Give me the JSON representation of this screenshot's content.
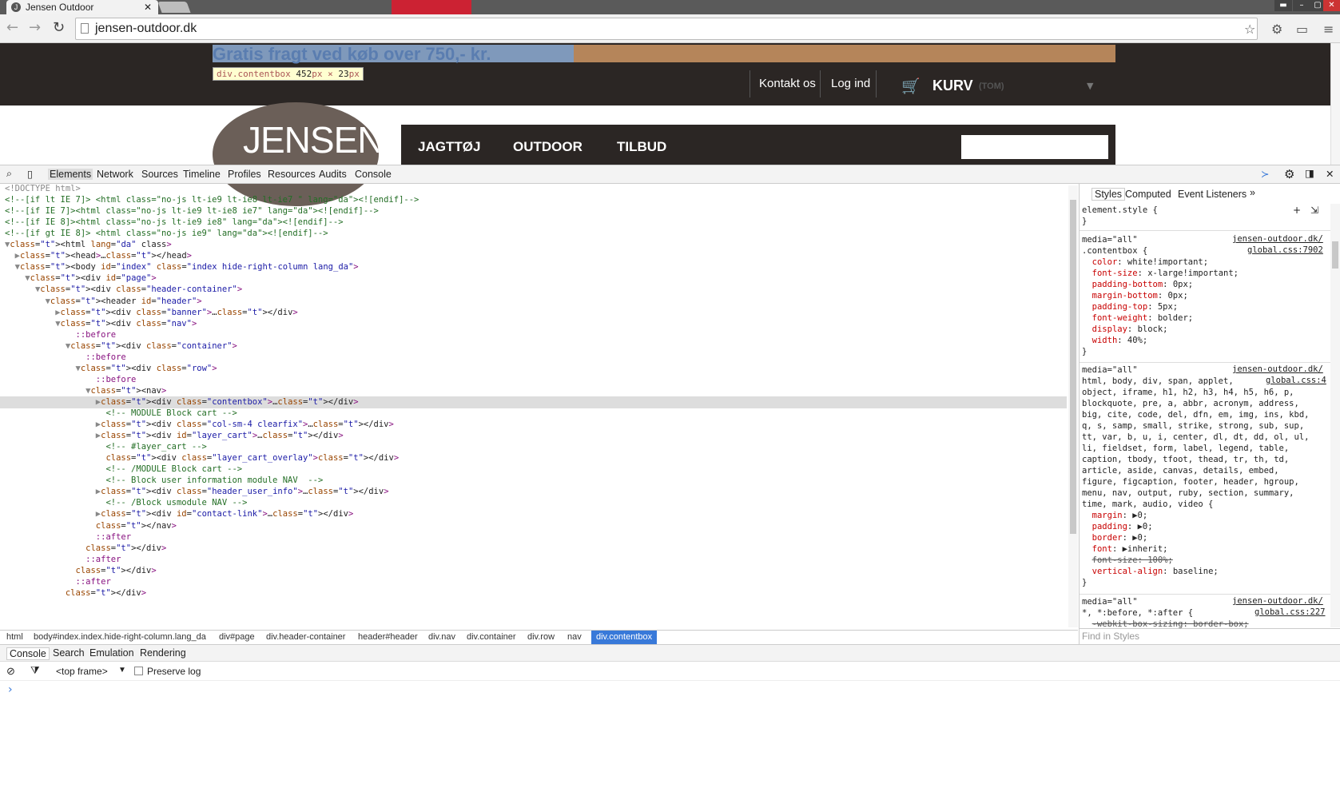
{
  "browser": {
    "tab_title": "Jensen Outdoor",
    "url": "jensen-outdoor.dk"
  },
  "site": {
    "promo": "Gratis fragt ved køb over 750,- kr.",
    "tooltip_selector": "div.contentbox",
    "tooltip_width": "452",
    "tooltip_height": "23",
    "tooltip_px": "px",
    "tooltip_x": "×",
    "contact": "Kontakt os",
    "login": "Log ind",
    "cart": "KURV",
    "cart_status": "(TOM)",
    "logo": "JENSEN",
    "menu": [
      "JAGTTØJ",
      "OUTDOOR",
      "TILBUD"
    ]
  },
  "devtools": {
    "tabs": [
      "Elements",
      "Network",
      "Sources",
      "Timeline",
      "Profiles",
      "Resources",
      "Audits",
      "Console"
    ],
    "code_lines": [
      "<!DOCTYPE html>",
      "<!--[if lt IE 7]> <html class=\"no-js lt-ie9 lt-ie8 lt-ie7 \" lang=\"da\"><![endif]-->",
      "<!--[if IE 7]><html class=\"no-js lt-ie9 lt-ie8 ie7\" lang=\"da\"><![endif]-->",
      "<!--[if IE 8]><html class=\"no-js lt-ie9 ie8\" lang=\"da\"><![endif]-->",
      "<!--[if gt IE 8]> <html class=\"no-js ie9\" lang=\"da\"><![endif]-->",
      "▼<html lang=\"da\" class>",
      "  ▶<head>…</head>",
      "  ▼<body id=\"index\" class=\"index hide-right-column lang_da\">",
      "    ▼<div id=\"page\">",
      "      ▼<div class=\"header-container\">",
      "        ▼<header id=\"header\">",
      "          ▶<div class=\"banner\">…</div>",
      "          ▼<div class=\"nav\">",
      "              ::before",
      "            ▼<div class=\"container\">",
      "                ::before",
      "              ▼<div class=\"row\">",
      "                  ::before",
      "                ▼<nav>",
      "                  ▶<div class=\"contentbox\">…</div>",
      "                    <!-- MODULE Block cart -->",
      "                  ▶<div class=\"col-sm-4 clearfix\">…</div>",
      "                  ▶<div id=\"layer_cart\">…</div>",
      "                    <!-- #layer_cart -->",
      "                    <div class=\"layer_cart_overlay\"></div>",
      "                    <!-- /MODULE Block cart -->",
      "                    <!-- Block user information module NAV  -->",
      "                  ▶<div class=\"header_user_info\">…</div>",
      "                    <!-- /Block usmodule NAV -->",
      "                  ▶<div id=\"contact-link\">…</div>",
      "                  </nav>",
      "                  ::after",
      "                </div>",
      "                ::after",
      "              </div>",
      "              ::after",
      "            </div>"
    ],
    "breadcrumbs": [
      "html",
      "body#index.index.hide-right-column.lang_da",
      "div#page",
      "div.header-container",
      "header#header",
      "div.nav",
      "div.container",
      "div.row",
      "nav",
      "div.contentbox"
    ],
    "styles_tabs": [
      "Styles",
      "Computed",
      "Event Listeners",
      "»"
    ],
    "element_style": "element.style {",
    "close_brace": "}",
    "rule1": {
      "media": "media=\"all\"",
      "src1": "jensen-outdoor.dk/",
      "src2": "global.css:7902",
      "selector": ".contentbox {",
      "props": [
        [
          "color",
          "white!important;"
        ],
        [
          "font-size",
          "x-large!important;"
        ],
        [
          "padding-bottom",
          "0px;"
        ],
        [
          "margin-bottom",
          "0px;"
        ],
        [
          "padding-top",
          "5px;"
        ],
        [
          "font-weight",
          "bolder;"
        ],
        [
          "display",
          "block;"
        ],
        [
          "width",
          "40%;"
        ]
      ]
    },
    "rule2": {
      "media": "media=\"all\"",
      "src1": "jensen-outdoor.dk/",
      "src2": "global.css:4",
      "selector_lines": [
        "html, body, div, span, applet,",
        "object, iframe, h1, h2, h3, h4, h5, h6, p,",
        "blockquote, pre, a, abbr, acronym, address,",
        "big, cite, code, del, dfn, em, img, ins, kbd,",
        "q, s, samp, small, strike, strong, sub, sup,",
        "tt, var, b, u, i, center, dl, dt, dd, ol, ul,",
        "li, fieldset, form, label, legend, table,",
        "caption, tbody, tfoot, thead, tr, th, td,",
        "article, aside, canvas, details, embed,",
        "figure, figcaption, footer, header, hgroup,",
        "menu, nav, output, ruby, section, summary,",
        "time, mark, audio, video {"
      ],
      "props": [
        [
          "margin",
          "▶0;"
        ],
        [
          "padding",
          "▶0;"
        ],
        [
          "border",
          "▶0;"
        ],
        [
          "font",
          "▶inherit;"
        ],
        [
          "font-size",
          "100%;"
        ],
        [
          "vertical-align",
          "baseline;"
        ]
      ]
    },
    "rule3": {
      "media": "media=\"all\"",
      "src1": "jensen-outdoor.dk/",
      "src2": "global.css:227",
      "selector": "*, *:before, *:after {",
      "prop": "-webkit-box-sizing: border-box;"
    },
    "find_styles": "Find in Styles",
    "drawer_tabs": [
      "Console",
      "Search",
      "Emulation",
      "Rendering"
    ],
    "frame": "<top frame>",
    "preserve_log": "Preserve log",
    "prompt": "›"
  }
}
